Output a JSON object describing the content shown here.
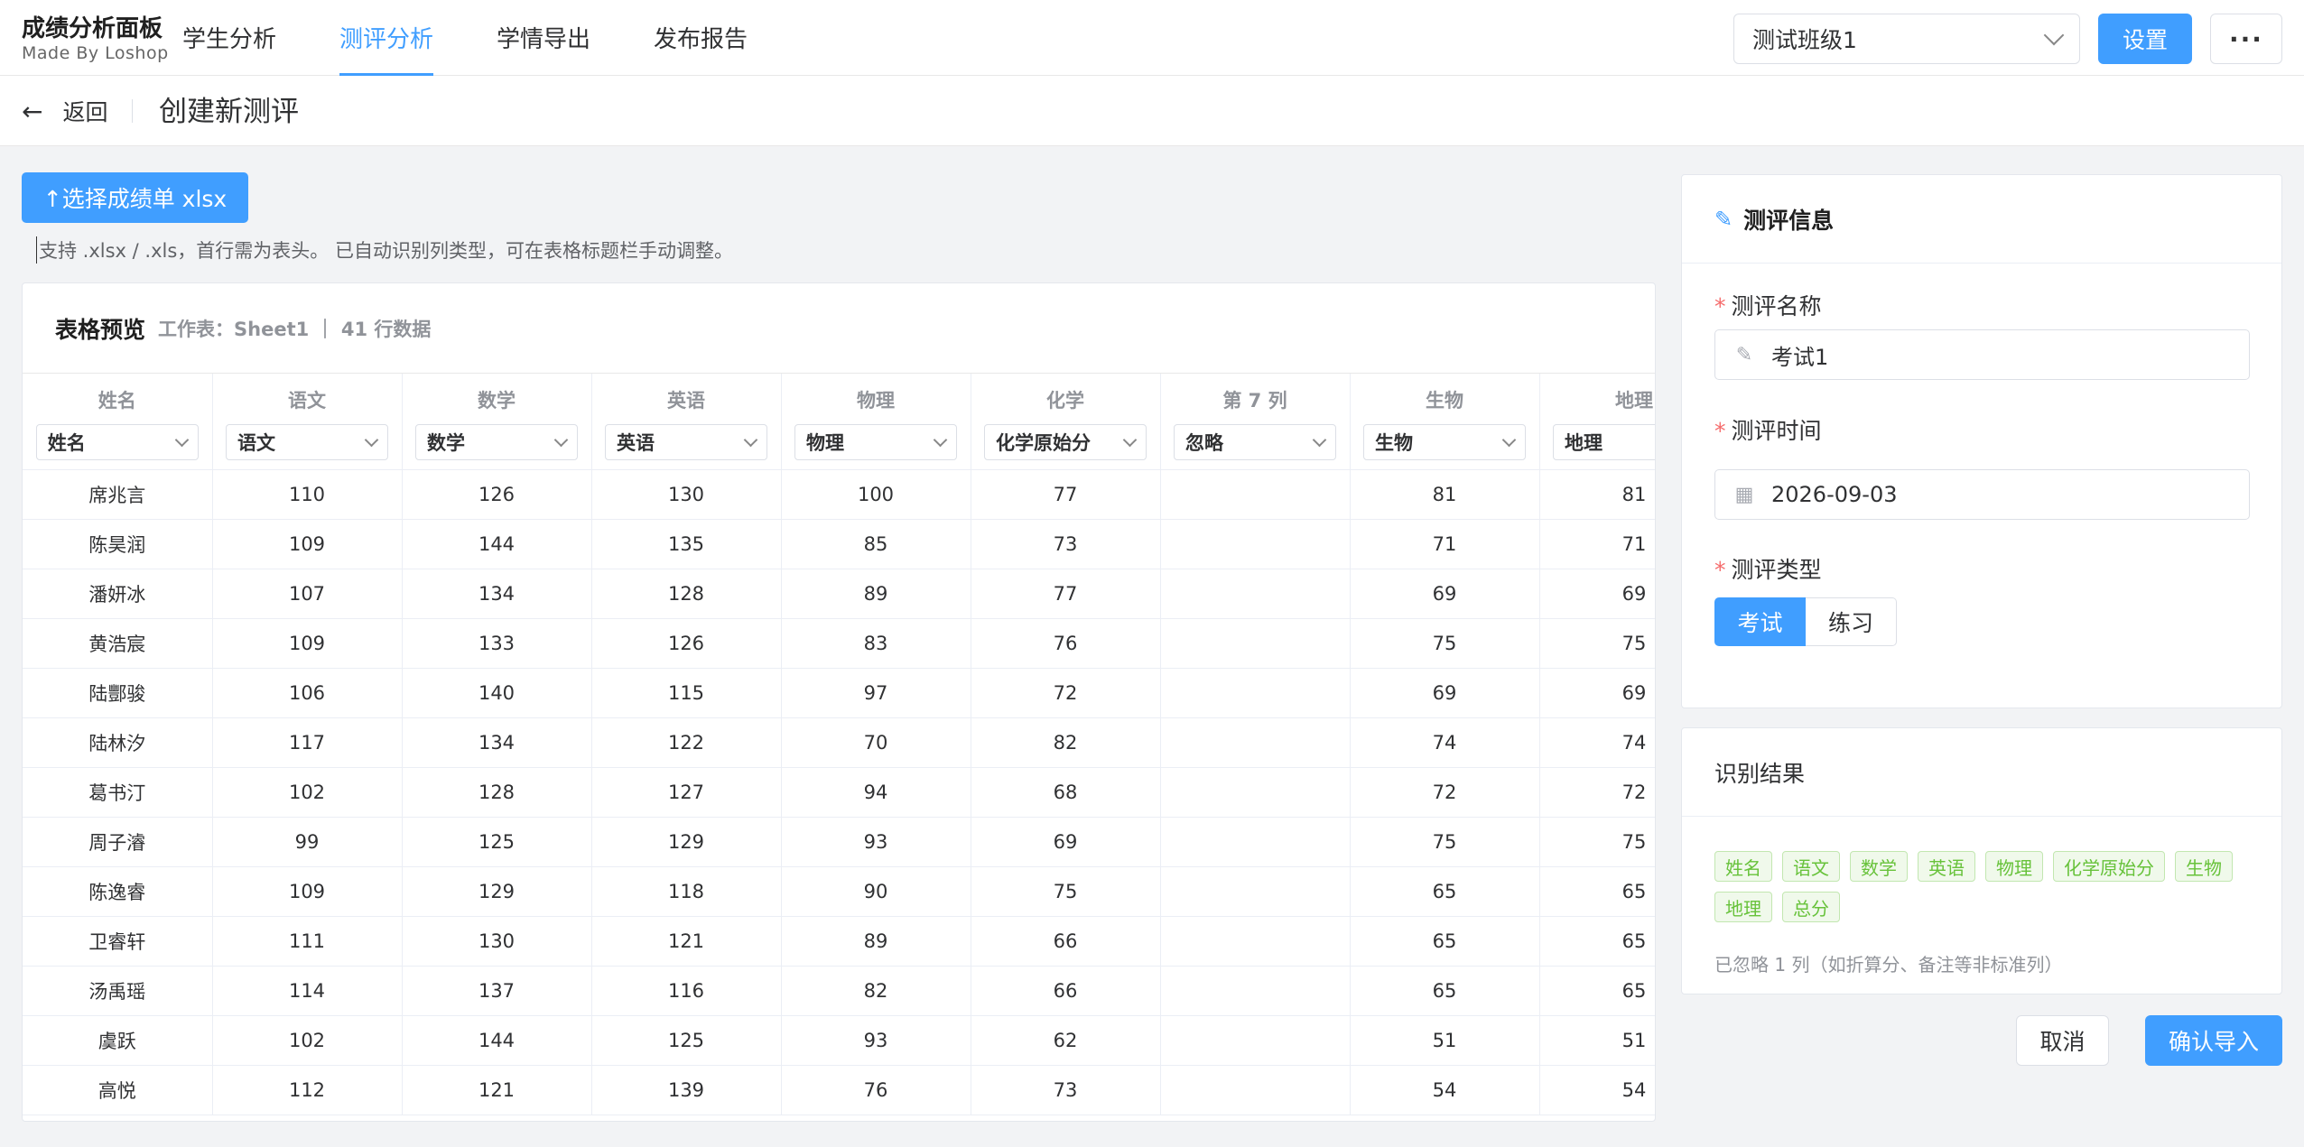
{
  "brand": {
    "title": "成绩分析面板",
    "subtitle": "Made By Loshop"
  },
  "nav": [
    {
      "label": "学生分析",
      "active": false
    },
    {
      "label": "测评分析",
      "active": true
    },
    {
      "label": "学情导出",
      "active": false
    },
    {
      "label": "发布报告",
      "active": false
    }
  ],
  "class_select": {
    "value": "测试班级1"
  },
  "header_buttons": {
    "settings": "设置",
    "more": "···"
  },
  "page": {
    "back_label": "返回",
    "title": "创建新测评"
  },
  "upload": {
    "button_label": "↑选择成绩单 xlsx",
    "hint": "支持 .xlsx / .xls，首行需为表头。 已自动识别列类型，可在表格标题栏手动调整。"
  },
  "preview": {
    "title": "表格预览",
    "meta": "工作表：Sheet1 ｜ 41 行数据",
    "columns": [
      {
        "header": "姓名",
        "mapping": "姓名"
      },
      {
        "header": "语文",
        "mapping": "语文"
      },
      {
        "header": "数学",
        "mapping": "数学"
      },
      {
        "header": "英语",
        "mapping": "英语"
      },
      {
        "header": "物理",
        "mapping": "物理"
      },
      {
        "header": "化学",
        "mapping": "化学原始分"
      },
      {
        "header": "第 7 列",
        "mapping": "忽略"
      },
      {
        "header": "生物",
        "mapping": "生物"
      },
      {
        "header": "地理",
        "mapping": "地理"
      }
    ],
    "rows": [
      [
        "席兆言",
        "110",
        "126",
        "130",
        "100",
        "77",
        "",
        "81",
        "81"
      ],
      [
        "陈昊润",
        "109",
        "144",
        "135",
        "85",
        "73",
        "",
        "71",
        "71"
      ],
      [
        "潘妍冰",
        "107",
        "134",
        "128",
        "89",
        "77",
        "",
        "69",
        "69"
      ],
      [
        "黄浩宸",
        "109",
        "133",
        "126",
        "83",
        "76",
        "",
        "75",
        "75"
      ],
      [
        "陆酆骏",
        "106",
        "140",
        "115",
        "97",
        "72",
        "",
        "69",
        "69"
      ],
      [
        "陆林汐",
        "117",
        "134",
        "122",
        "70",
        "82",
        "",
        "74",
        "74"
      ],
      [
        "葛书汀",
        "102",
        "128",
        "127",
        "94",
        "68",
        "",
        "72",
        "72"
      ],
      [
        "周子濬",
        "99",
        "125",
        "129",
        "93",
        "69",
        "",
        "75",
        "75"
      ],
      [
        "陈逸睿",
        "109",
        "129",
        "118",
        "90",
        "75",
        "",
        "65",
        "65"
      ],
      [
        "卫睿轩",
        "111",
        "130",
        "121",
        "89",
        "66",
        "",
        "65",
        "65"
      ],
      [
        "汤禹瑶",
        "114",
        "137",
        "116",
        "82",
        "66",
        "",
        "65",
        "65"
      ],
      [
        "虞跃",
        "102",
        "144",
        "125",
        "93",
        "62",
        "",
        "51",
        "51"
      ],
      [
        "高悦",
        "112",
        "121",
        "139",
        "76",
        "73",
        "",
        "54",
        "54"
      ]
    ]
  },
  "info": {
    "title": "测评信息",
    "name_label": "测评名称",
    "name_value": "考试1",
    "date_label": "测评时间",
    "date_value": "2026-09-03",
    "type_label": "测评类型",
    "type_options": [
      "考试",
      "练习"
    ],
    "type_selected": "考试"
  },
  "result": {
    "title": "识别结果",
    "tags": [
      "姓名",
      "语文",
      "数学",
      "英语",
      "物理",
      "化学原始分",
      "生物",
      "地理",
      "总分"
    ],
    "ignored_note": "已忽略 1 列（如折算分、备注等非标准列）"
  },
  "footer": {
    "cancel": "取消",
    "confirm": "确认导入"
  },
  "colors": {
    "primary": "#409eff",
    "tag_green": "#67c23a",
    "required": "#f56c6c"
  }
}
